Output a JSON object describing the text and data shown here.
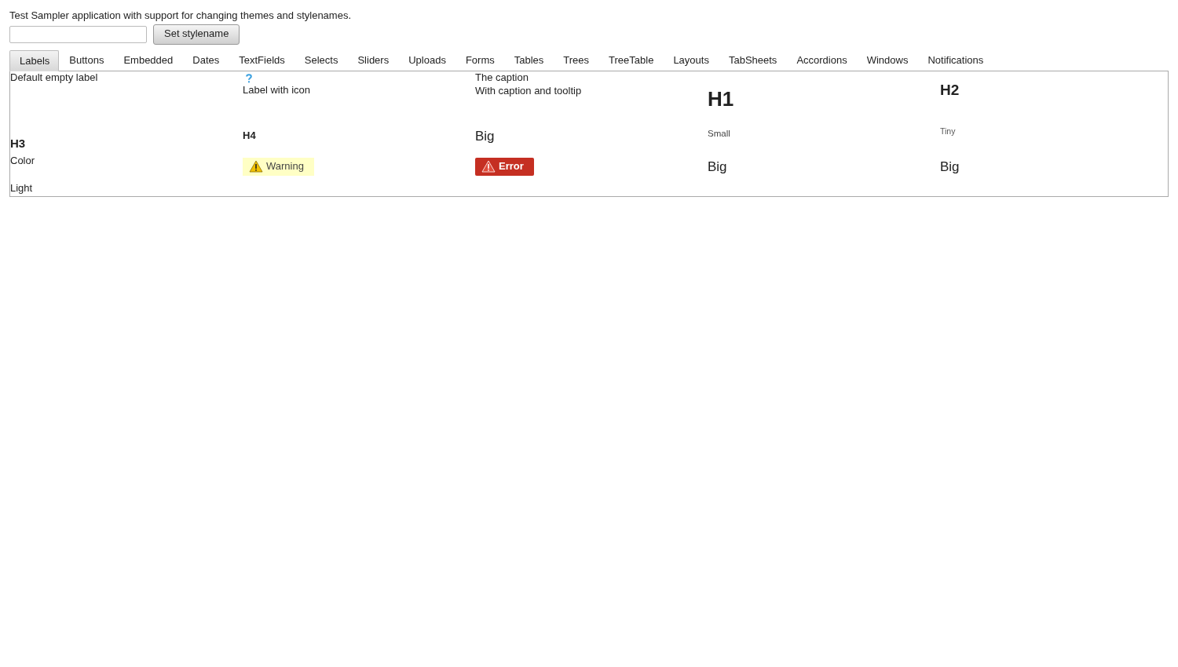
{
  "intro": "Test Sampler application with support for changing themes and stylenames.",
  "stylename": {
    "button": "Set stylename"
  },
  "tabs": [
    {
      "label": "Labels",
      "selected": true
    },
    {
      "label": "Buttons",
      "selected": false
    },
    {
      "label": "Embedded",
      "selected": false
    },
    {
      "label": "Dates",
      "selected": false
    },
    {
      "label": "TextFields",
      "selected": false
    },
    {
      "label": "Selects",
      "selected": false
    },
    {
      "label": "Sliders",
      "selected": false
    },
    {
      "label": "Uploads",
      "selected": false
    },
    {
      "label": "Forms",
      "selected": false
    },
    {
      "label": "Tables",
      "selected": false
    },
    {
      "label": "Trees",
      "selected": false
    },
    {
      "label": "TreeTable",
      "selected": false
    },
    {
      "label": "Layouts",
      "selected": false
    },
    {
      "label": "TabSheets",
      "selected": false
    },
    {
      "label": "Accordions",
      "selected": false
    },
    {
      "label": "Windows",
      "selected": false
    },
    {
      "label": "Notifications",
      "selected": false
    }
  ],
  "rows": [
    [
      {
        "kind": "plain",
        "text": "Default empty label"
      },
      {
        "kind": "icon",
        "text": "Label with icon"
      },
      {
        "kind": "caption",
        "caption": "The caption",
        "text": "With caption and tooltip"
      },
      {
        "kind": "h1",
        "text": "H1"
      },
      {
        "kind": "h2",
        "text": "H2"
      }
    ],
    [
      {
        "kind": "h3",
        "text": "H3"
      },
      {
        "kind": "h4",
        "text": "H4"
      },
      {
        "kind": "big",
        "text": "Big"
      },
      {
        "kind": "small",
        "text": "Small"
      },
      {
        "kind": "tiny",
        "text": "Tiny"
      }
    ],
    [
      {
        "kind": "plain",
        "text": "Color"
      },
      {
        "kind": "warning",
        "text": "Warning"
      },
      {
        "kind": "error",
        "text": "Error"
      },
      {
        "kind": "big",
        "text": "Big"
      },
      {
        "kind": "big",
        "text": "Big"
      }
    ],
    [
      {
        "kind": "light",
        "text": "Light"
      }
    ]
  ]
}
